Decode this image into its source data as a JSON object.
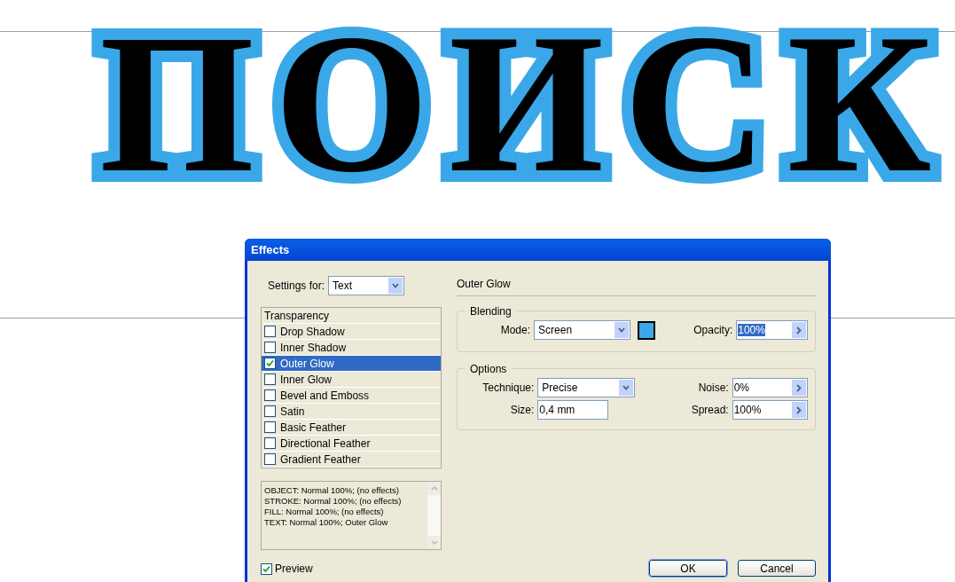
{
  "canvas": {
    "headline": "ПОИСК"
  },
  "dialog": {
    "title": "Effects"
  },
  "settings_for": {
    "label": "Settings for:",
    "value": "Text"
  },
  "effects": [
    {
      "label": "Transparency",
      "kind": "header",
      "selected": false
    },
    {
      "label": "Drop Shadow",
      "kind": "checkbox",
      "checked": false,
      "selected": false
    },
    {
      "label": "Inner Shadow",
      "kind": "checkbox",
      "checked": false,
      "selected": false
    },
    {
      "label": "Outer Glow",
      "kind": "checkbox",
      "checked": true,
      "selected": true
    },
    {
      "label": "Inner Glow",
      "kind": "checkbox",
      "checked": false,
      "selected": false
    },
    {
      "label": "Bevel and Emboss",
      "kind": "checkbox",
      "checked": false,
      "selected": false
    },
    {
      "label": "Satin",
      "kind": "checkbox",
      "checked": false,
      "selected": false
    },
    {
      "label": "Basic Feather",
      "kind": "checkbox",
      "checked": false,
      "selected": false
    },
    {
      "label": "Directional Feather",
      "kind": "checkbox",
      "checked": false,
      "selected": false
    },
    {
      "label": "Gradient Feather",
      "kind": "checkbox",
      "checked": false,
      "selected": false
    }
  ],
  "summary": [
    "OBJECT: Normal 100%; (no effects)",
    "STROKE: Normal 100%; (no effects)",
    "FILL: Normal 100%; (no effects)",
    "TEXT: Normal 100%; Outer Glow"
  ],
  "preview": {
    "label": "Preview",
    "checked": true
  },
  "panel_title": "Outer Glow",
  "blending": {
    "title": "Blending",
    "mode": {
      "label": "Mode:",
      "value": "Screen"
    },
    "color": "#3aa8e8",
    "opacity": {
      "label": "Opacity:",
      "value": "100%",
      "selected": true
    }
  },
  "options": {
    "title": "Options",
    "technique": {
      "label": "Technique:",
      "value": "Precise"
    },
    "noise": {
      "label": "Noise:",
      "value": "0%"
    },
    "size": {
      "label": "Size:",
      "value": "0,4 mm"
    },
    "spread": {
      "label": "Spread:",
      "value": "100%"
    }
  },
  "buttons": [
    "OK",
    "Cancel"
  ]
}
